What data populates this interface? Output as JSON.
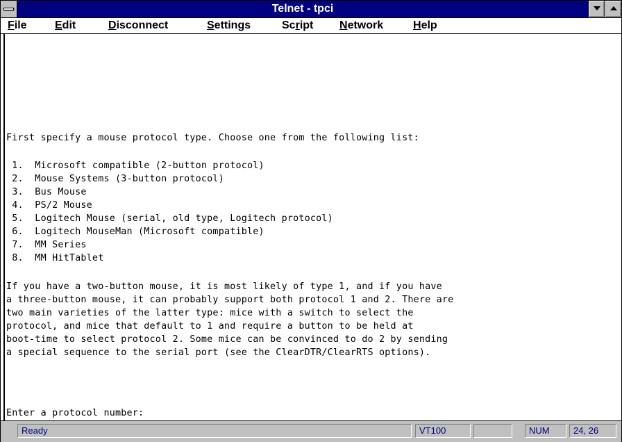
{
  "window": {
    "title": "Telnet - tpci"
  },
  "menu": [
    {
      "label": "File",
      "ul": "F",
      "rest": "ile"
    },
    {
      "label": "Edit",
      "ul": "E",
      "rest": "dit"
    },
    {
      "label": "Disconnect",
      "ul": "D",
      "rest": "isconnect"
    },
    {
      "label": "Settings",
      "ul": "S",
      "rest": "ettings"
    },
    {
      "label": "Script",
      "pre": "Sc",
      "ul": "r",
      "rest": "ipt"
    },
    {
      "label": "Network",
      "ul": "N",
      "rest": "etwork"
    },
    {
      "label": "Help",
      "ul": "H",
      "rest": "elp"
    }
  ],
  "terminal": {
    "lines": [
      "First specify a mouse protocol type. Choose one from the following list:",
      "",
      " 1.  Microsoft compatible (2-button protocol)",
      " 2.  Mouse Systems (3-button protocol)",
      " 3.  Bus Mouse",
      " 4.  PS/2 Mouse",
      " 5.  Logitech Mouse (serial, old type, Logitech protocol)",
      " 6.  Logitech MouseMan (Microsoft compatible)",
      " 7.  MM Series",
      " 8.  MM HitTablet",
      "",
      "If you have a two-button mouse, it is most likely of type 1, and if you have",
      "a three-button mouse, it can probably support both protocol 1 and 2. There are",
      "two main varieties of the latter type: mice with a switch to select the",
      "protocol, and mice that default to 1 and require a button to be held at",
      "boot-time to select protocol 2. Some mice can be convinced to do 2 by sending",
      "a special sequence to the serial port (see the ClearDTR/ClearRTS options).",
      "",
      "Enter a protocol number:"
    ]
  },
  "status": {
    "ready": "Ready",
    "terminal_type": "VT100",
    "blank": "",
    "num": "NUM",
    "cursor": "24, 26"
  }
}
